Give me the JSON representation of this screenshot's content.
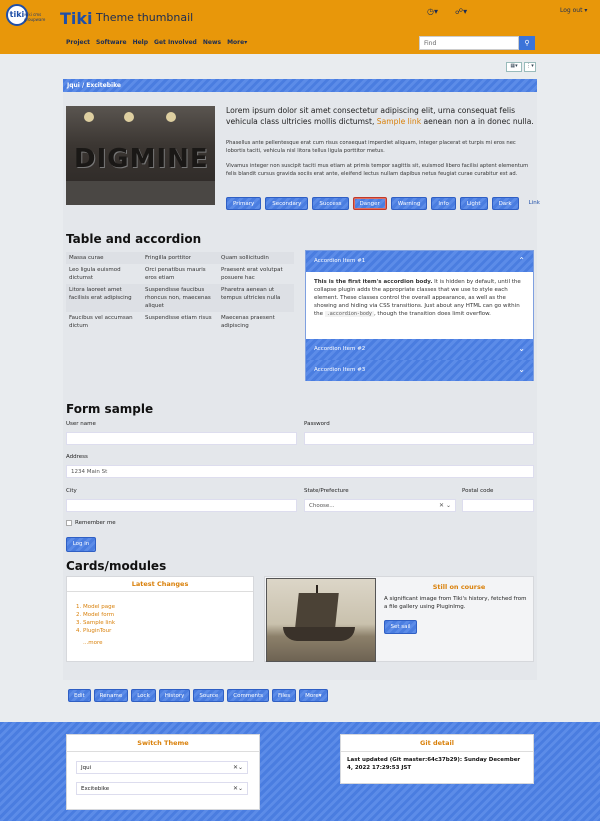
{
  "header": {
    "logo_mark": "tiki",
    "logo_text": "wiki cms groupware",
    "brand": "Tiki",
    "site_title": "Theme thumbnail",
    "clock_icon": "clock-icon",
    "share_icon": "share-icon",
    "logout": "Log out",
    "nav": [
      "Project",
      "Software",
      "Help",
      "Get Involved",
      "News",
      "More▾"
    ],
    "search_placeholder": "Find",
    "accent": "#e8970a"
  },
  "breadcrumb": "Jqui / Excitebike",
  "hero": {
    "lead_prefix": "Lorem ipsum dolor sit amet consectetur adipiscing elit, urna consequat felis vehicula class ultricies mollis dictumst, ",
    "lead_link": "Sample link",
    "lead_suffix": " aenean non a in donec nulla.",
    "para1": "Phasellus ante pellentesque erat cum risus consequat imperdiet aliquam, integer placerat et turpis mi eros nec lobortis taciti, vehicula nisl litora tellus ligula porttitor metus.",
    "para2": "Vivamus integer non suscipit taciti mus etiam at primis tempor sagittis sit, euismod libero facilisi aptent elementum felis blandit cursus gravida sociis erat ante, eleifend lectus nullam dapibus netus feugiat curae curabitur est ad.",
    "buttons": [
      "Primary",
      "Secondary",
      "Success",
      "Danger",
      "Warning",
      "Info",
      "Light",
      "Dark",
      "Link"
    ]
  },
  "table_section": {
    "heading": "Table and accordion",
    "rows": [
      [
        "Massa curae",
        "Fringilla porttitor",
        "Quam sollicitudin"
      ],
      [
        "Leo ligula euismod dictumst",
        "Orci penatibus mauris eros etiam",
        "Praesent erat volutpat posuere hac"
      ],
      [
        "Litora laoreet amet facilisis erat adipiscing",
        "Suspendisse faucibus rhoncus non, maecenas aliquet",
        "Pharetra aenean ut tempus ultricies nulla"
      ],
      [
        "Faucibus vel accumsan dictum",
        "Suspendisse etiam risus",
        "Maecenas praesent adipiscing"
      ]
    ],
    "accordion": [
      {
        "title": "Accordion Item #1"
      },
      {
        "title": "Accordion Item #2"
      },
      {
        "title": "Accordion Item #3"
      }
    ],
    "accordion_body_bold": "This is the first item's accordion body.",
    "accordion_body_text": " It is hidden by default, until the collapse plugin adds the appropriate classes that we use to style each element. These classes control the overall appearance, as well as the showing and hiding via CSS transitions. Just about any HTML can go within the ",
    "accordion_body_code": ".accordion-body",
    "accordion_body_end": ", though the transition does limit overflow."
  },
  "form": {
    "heading": "Form sample",
    "user_label": "User name",
    "password_label": "Password",
    "address_label": "Address",
    "address_placeholder": "1234 Main St",
    "city_label": "City",
    "state_label": "State/Prefecture",
    "state_value": "Choose...",
    "postal_label": "Postal code",
    "remember": "Remember me",
    "login": "Log in"
  },
  "cards": {
    "heading": "Cards/modules",
    "latest_title": "Latest Changes",
    "latest_items": [
      "Model page",
      "Model form",
      "Sample link",
      "PluginTour"
    ],
    "latest_more": "...more",
    "still_title": "Still on course",
    "still_text": "A significant image from Tiki's history, fetched from a file gallery using PluginImg.",
    "still_button": "Set sail"
  },
  "actions": [
    "Edit",
    "Rename",
    "Lock",
    "History",
    "Source",
    "Comments",
    "Files",
    "More▾"
  ],
  "footer": {
    "switch_theme_title": "Switch Theme",
    "theme_value": "Jqui",
    "option_value": "Excitebike",
    "git_title": "Git detail",
    "git_text": "Last updated (Git master:64c37b29): Sunday December 4, 2022 17:29:53 JST"
  }
}
